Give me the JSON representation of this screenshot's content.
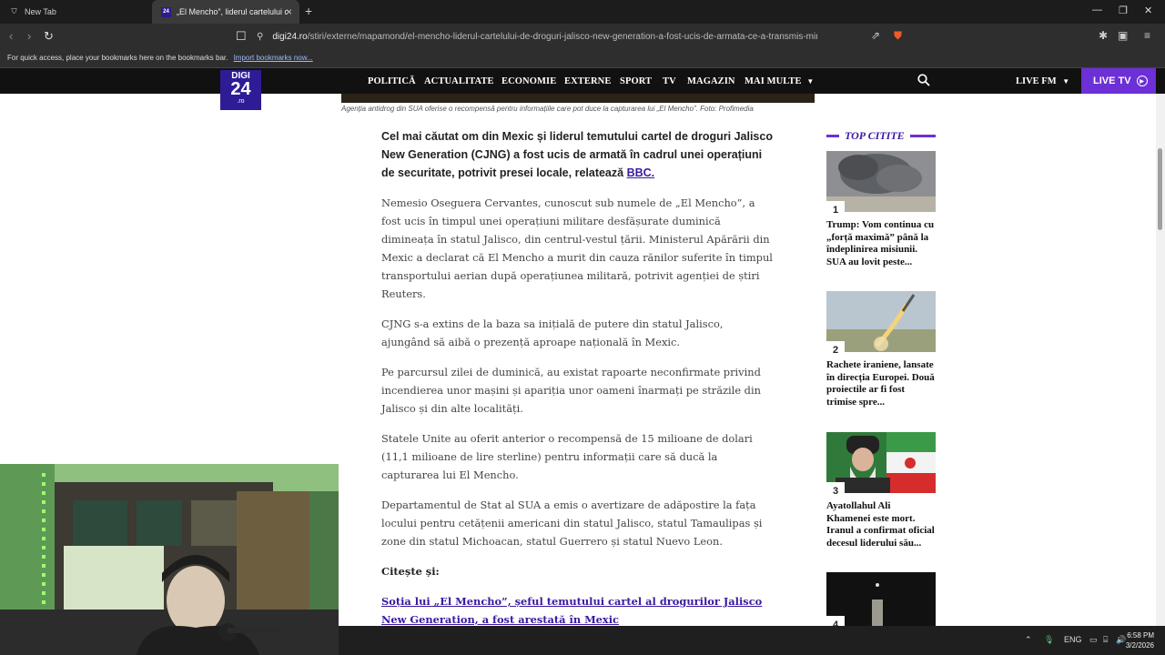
{
  "browser": {
    "tabs": [
      {
        "title": "New Tab",
        "active": false
      },
      {
        "title": "„El Mencho”, liderul cartelului d",
        "active": true
      }
    ],
    "url_host": "digi24.ro",
    "url_path": "/stiri/externe/mapamond/el-mencho-liderul-cartelului-de-droguri-jalisco-new-generation-a-fost-ucis-de-armata-ce-a-transmis-ministerul-apararii...",
    "bookmarks_hint": "For quick access, place your bookmarks here on the bookmarks bar.",
    "import_link": "Import bookmarks now..."
  },
  "site": {
    "logo_top": "DIGI",
    "logo_main": "24",
    "logo_sub": ".ro",
    "nav": [
      "POLITICĂ",
      "ACTUALITATE",
      "ECONOMIE",
      "EXTERNE",
      "SPORT",
      "TV",
      "MAGAZIN",
      "MAI MULTE"
    ],
    "live_fm": "LIVE FM",
    "live_tv": "LIVE TV"
  },
  "article": {
    "caption": "Agenția antidrog din SUA oferise o recompensă pentru informațiile care pot duce la capturarea lui „El Mencho”. Foto: Profimedia",
    "lead": "Cel mai căutat om din Mexic și liderul temutului cartel de droguri Jalisco New Generation (CJNG) a fost ucis de armată în cadrul unei operațiuni de securitate, potrivit presei locale, relatează",
    "lead_link": "BBC.",
    "paragraphs": [
      "Nemesio Oseguera Cervantes, cunoscut sub numele de „El Mencho”, a fost ucis în timpul unei operațiuni militare desfășurate duminică dimineața în statul Jalisco, din centrul-vestul țării. Ministerul Apărării din Mexic a declarat că El Mencho a murit din cauza rănilor suferite în timpul transportului aerian după operațiunea militară, potrivit agenției de știri Reuters.",
      "CJNG s-a extins de la baza sa inițială de putere din statul Jalisco, ajungând să aibă o prezență aproape națională în Mexic.",
      "Pe parcursul zilei de duminică, au existat rapoarte neconfirmate privind incendierea unor mașini și apariția unor oameni înarmați pe străzile din Jalisco și din alte localități.",
      "Statele Unite au oferit anterior o recompensă de 15 milioane de dolari (11,1 milioane de lire sterline) pentru informații care să ducă la capturarea lui El Mencho.",
      "Departamentul de Stat al SUA a emis o avertizare de adăpostire la fața locului pentru cetățenii americani din statul Jalisco, statul Tamaulipas și zone din statul Michoacan, statul Guerrero și statul Nuevo Leon."
    ],
    "read_also": "Citește și:",
    "related_link": "Soția lui „El Mencho”, șeful temutului cartel al drogurilor Jalisco New Generation, a fost arestată în Mexic"
  },
  "sidebar": {
    "title": "TOP CITITE",
    "items": [
      {
        "num": "1",
        "title": "Trump: Vom continua cu „forță maximă” până la îndeplinirea misiunii. SUA au lovit peste..."
      },
      {
        "num": "2",
        "title": "Rachete iraniene, lansate în direcția Europei. Două proiectile ar fi fost trimise spre..."
      },
      {
        "num": "3",
        "title": "Ayatollahul Ali Khamenei este mort. Iranul a confirmat oficial decesul liderului său..."
      },
      {
        "num": "4",
        "title": ""
      }
    ]
  },
  "taskbar": {
    "lang": "ENG",
    "time": "6:58 PM",
    "date": "3/2/2026"
  }
}
